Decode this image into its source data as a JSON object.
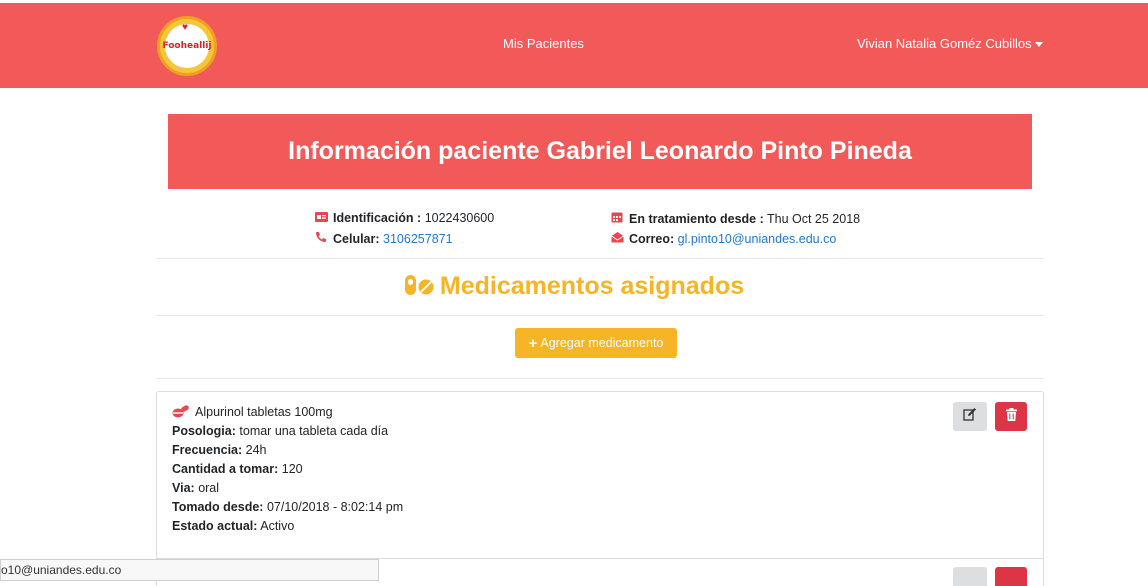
{
  "navbar": {
    "logo_text": "Fooheallij",
    "link_patients": "Mis Pacientes",
    "user_name": "Vivian Natalia Goméz Cubillos"
  },
  "banner": {
    "title": "Información paciente Gabriel Leonardo Pinto Pineda"
  },
  "patient": {
    "id_label": "Identificación :",
    "id_value": "1022430600",
    "phone_label": "Celular:",
    "phone_value": "3106257871",
    "since_label": "En tratamiento desde :",
    "since_value": "Thu Oct 25 2018",
    "email_label": "Correo:",
    "email_value": "gl.pinto10@uniandes.edu.co"
  },
  "medications": {
    "section_title": "Medicamentos asignados",
    "add_button": "Agregar medicamento",
    "items": [
      {
        "name": "Alpurinol tabletas 100mg",
        "posologia_label": "Posologia:",
        "posologia": "tomar una tableta cada día",
        "frecuencia_label": "Frecuencia:",
        "frecuencia": "24h",
        "cantidad_label": "Cantidad a tomar:",
        "cantidad": "120",
        "via_label": "Via:",
        "via": "oral",
        "desde_label": "Tomado desde:",
        "desde": "07/10/2018 - 8:02:14 pm",
        "estado_label": "Estado actual:",
        "estado": "Activo"
      }
    ]
  },
  "statusbar": {
    "url": "o10@uniandes.edu.co"
  },
  "colors": {
    "brand_red": "#f25a5a",
    "accent_yellow": "#f5b526",
    "danger": "#dc3545",
    "link": "#1e78d4"
  }
}
